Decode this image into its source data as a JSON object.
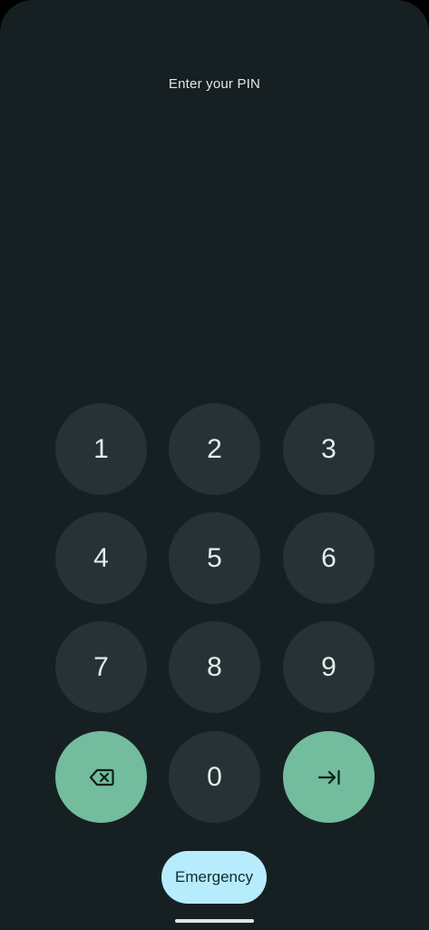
{
  "prompt": "Enter your PIN",
  "keys": {
    "k1": "1",
    "k2": "2",
    "k3": "3",
    "k4": "4",
    "k5": "5",
    "k6": "6",
    "k7": "7",
    "k8": "8",
    "k9": "9",
    "k0": "0",
    "backspace_icon": "backspace-icon",
    "enter_icon": "enter-arrow-icon"
  },
  "emergency_label": "Emergency",
  "colors": {
    "background": "#162023",
    "key": "#263236",
    "accent_key": "#73bc9d",
    "emergency": "#b7ecfc"
  }
}
